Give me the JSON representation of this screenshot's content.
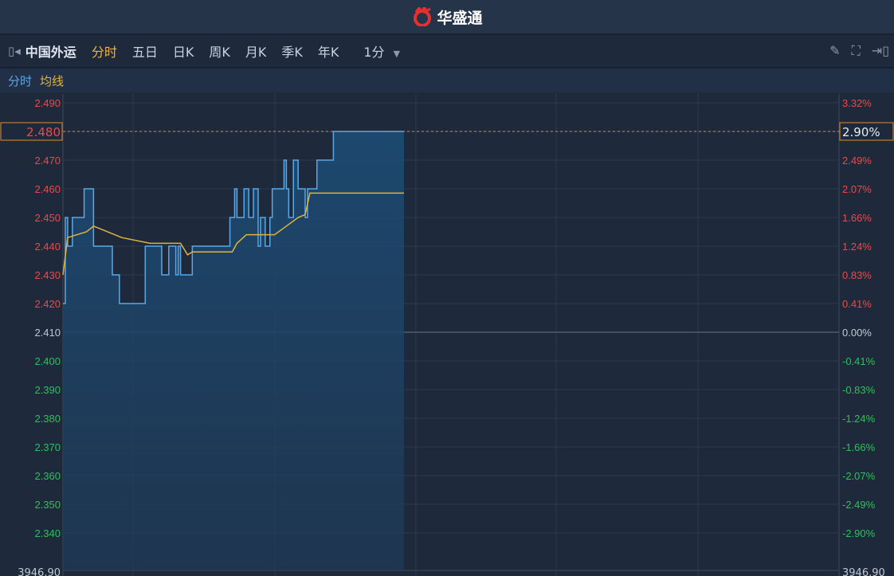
{
  "header": {
    "brand": "华盛通",
    "brand_color": "#e5302f"
  },
  "toolbar": {
    "stock": "中国外运",
    "tabs": [
      "分时",
      "五日",
      "日K",
      "周K",
      "月K",
      "季K",
      "年K"
    ],
    "active_tab": "分时",
    "interval": "1分"
  },
  "legend": {
    "price": "分时",
    "avg": "均线"
  },
  "colors": {
    "price": "#5aa8e6",
    "avg": "#e0b340",
    "up": "#e84a4a",
    "down": "#2fbf5c",
    "grid": "#2c3b50"
  },
  "current": {
    "price_label": "2.480",
    "pct_label": "2.90%"
  },
  "bottom": {
    "left": "3946.90",
    "right": "3946.90"
  },
  "chart_data": {
    "type": "line",
    "xlim": [
      0,
      330
    ],
    "ylim": [
      2.33,
      2.49
    ],
    "prev_close": 2.41,
    "y_ticks": [
      "2.490",
      "2.480",
      "2.470",
      "2.460",
      "2.450",
      "2.440",
      "2.430",
      "2.420",
      "2.410",
      "2.400",
      "2.390",
      "2.380",
      "2.370",
      "2.360",
      "2.350",
      "2.340"
    ],
    "pct_ticks": [
      "3.32%",
      "2.90%",
      "2.49%",
      "2.07%",
      "1.66%",
      "1.24%",
      "0.83%",
      "0.41%",
      "0.00%",
      "-0.41%",
      "-0.83%",
      "-1.24%",
      "-1.66%",
      "-2.07%",
      "-2.49%",
      "-2.90%"
    ],
    "series": [
      {
        "name": "分时",
        "step": true,
        "points": [
          [
            0,
            2.42
          ],
          [
            1,
            2.45
          ],
          [
            2,
            2.44
          ],
          [
            4,
            2.45
          ],
          [
            9,
            2.46
          ],
          [
            13,
            2.44
          ],
          [
            21,
            2.43
          ],
          [
            24,
            2.42
          ],
          [
            35,
            2.44
          ],
          [
            42,
            2.43
          ],
          [
            45,
            2.44
          ],
          [
            48,
            2.43
          ],
          [
            49,
            2.44
          ],
          [
            50,
            2.43
          ],
          [
            55,
            2.44
          ],
          [
            71,
            2.45
          ],
          [
            73,
            2.46
          ],
          [
            74,
            2.45
          ],
          [
            77,
            2.46
          ],
          [
            79,
            2.45
          ],
          [
            81,
            2.46
          ],
          [
            83,
            2.44
          ],
          [
            84,
            2.45
          ],
          [
            86,
            2.44
          ],
          [
            88,
            2.45
          ],
          [
            89,
            2.46
          ],
          [
            94,
            2.47
          ],
          [
            95,
            2.46
          ],
          [
            96,
            2.45
          ],
          [
            98,
            2.47
          ],
          [
            100,
            2.46
          ],
          [
            103,
            2.45
          ],
          [
            104,
            2.46
          ],
          [
            108,
            2.47
          ],
          [
            115,
            2.48
          ],
          [
            145,
            2.48
          ]
        ]
      },
      {
        "name": "均线",
        "step": false,
        "points": [
          [
            0,
            2.43
          ],
          [
            2,
            2.443
          ],
          [
            10,
            2.445
          ],
          [
            13,
            2.447
          ],
          [
            25,
            2.443
          ],
          [
            37,
            2.441
          ],
          [
            50,
            2.441
          ],
          [
            53,
            2.437
          ],
          [
            55,
            2.438
          ],
          [
            72,
            2.438
          ],
          [
            74,
            2.441
          ],
          [
            78,
            2.444
          ],
          [
            90,
            2.444
          ],
          [
            95,
            2.447
          ],
          [
            100,
            2.45
          ],
          [
            103,
            2.451
          ],
          [
            105,
            2.4585
          ],
          [
            145,
            2.4585
          ]
        ]
      }
    ]
  }
}
